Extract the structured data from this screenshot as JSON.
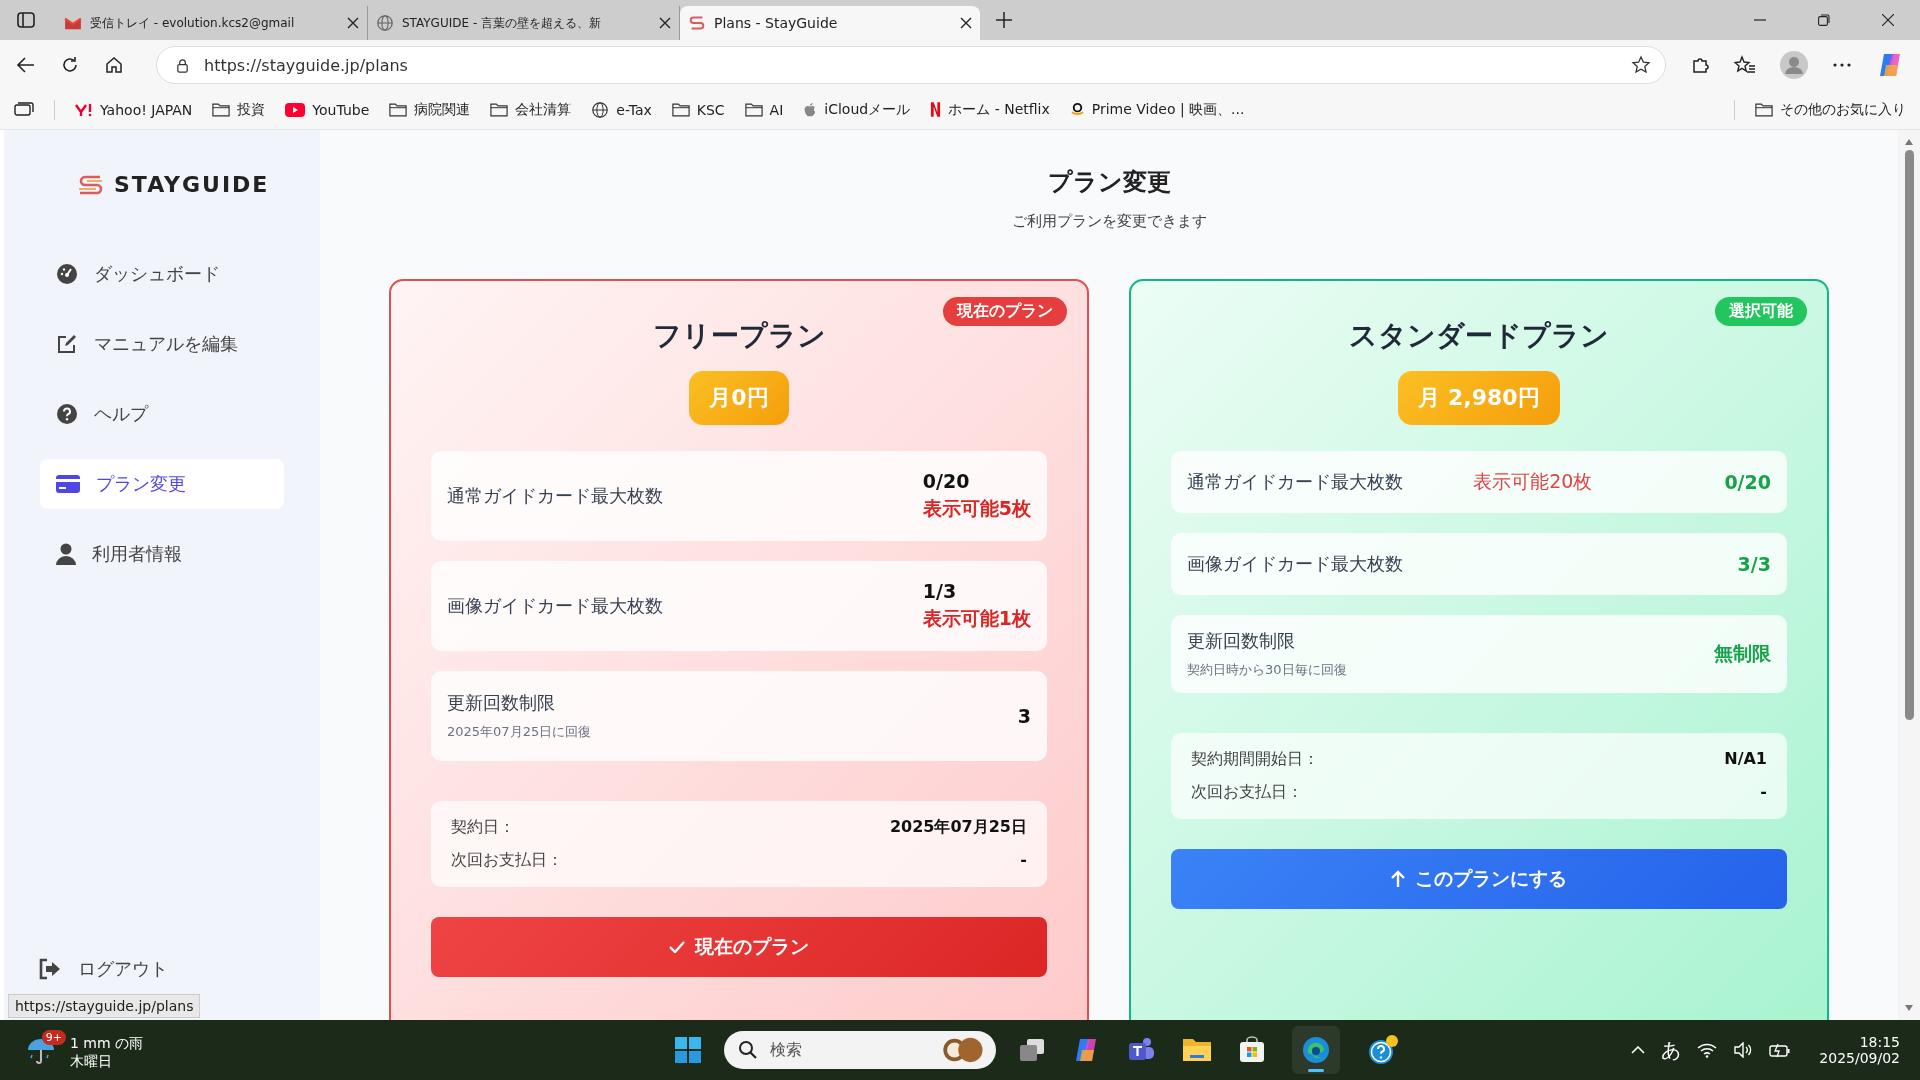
{
  "browser": {
    "tabs": [
      {
        "title": "受信トレイ - evolution.kcs2@gmail",
        "kind": "gmail",
        "selected": false
      },
      {
        "title": "STAYGUIDE - 言葉の壁を超える、新",
        "kind": "globe",
        "selected": false
      },
      {
        "title": "Plans - StayGuide",
        "kind": "stayguide",
        "selected": true
      }
    ],
    "address": "https://stayguide.jp/plans",
    "bookmarks": [
      {
        "label": "Yahoo! JAPAN",
        "kind": "yahoo"
      },
      {
        "label": "投資",
        "kind": "folder"
      },
      {
        "label": "YouTube",
        "kind": "youtube"
      },
      {
        "label": "病院関連",
        "kind": "folder"
      },
      {
        "label": "会社清算",
        "kind": "folder"
      },
      {
        "label": "e-Tax",
        "kind": "globe"
      },
      {
        "label": "KSC",
        "kind": "folder"
      },
      {
        "label": "AI",
        "kind": "folder"
      },
      {
        "label": "iCloudメール",
        "kind": "apple"
      },
      {
        "label": "ホーム - Netflix",
        "kind": "netflix"
      },
      {
        "label": "Prime Video | 映画、...",
        "kind": "amazon"
      }
    ],
    "other_bookmarks": "その他のお気に入り"
  },
  "sidebar": {
    "logo": "STAYGUIDE",
    "items": [
      {
        "label": "ダッシュボード",
        "kind": "dashboard",
        "selected": false
      },
      {
        "label": "マニュアルを編集",
        "kind": "edit",
        "selected": false
      },
      {
        "label": "ヘルプ",
        "kind": "help",
        "selected": false
      },
      {
        "label": "プラン変更",
        "kind": "card",
        "selected": true
      },
      {
        "label": "利用者情報",
        "kind": "user",
        "selected": false
      }
    ],
    "logout": "ログアウト"
  },
  "status_url": "https://stayguide.jp/plans",
  "page": {
    "title": "プラン変更",
    "subtitle": "ご利用プランを変更できます"
  },
  "plans": [
    {
      "kind": "current",
      "name": "フリープラン",
      "badge": "現在のプラン",
      "price": "月0円",
      "features": [
        {
          "label": "通常ガイドカード最大枚数",
          "value": "0/20",
          "note": "表示可能5枚"
        },
        {
          "label": "画像ガイドカード最大枚数",
          "value": "1/3",
          "note": "表示可能1枚"
        },
        {
          "label": "更新回数制限",
          "value": "3",
          "sub": "2025年07月25日に回復"
        }
      ],
      "contract": [
        {
          "label": "契約日：",
          "value": "2025年07月25日"
        },
        {
          "label": "次回お支払日：",
          "value": "-"
        }
      ],
      "button": "現在のプラン"
    },
    {
      "kind": "available",
      "name": "スタンダードプラン",
      "badge": "選択可能",
      "price": "月 2,980円",
      "features": [
        {
          "label": "通常ガイドカード最大枚数",
          "value": "0/20",
          "note": "表示可能20枚"
        },
        {
          "label": "画像ガイドカード最大枚数",
          "value": "3/3"
        },
        {
          "label": "更新回数制限",
          "value": "無制限",
          "sub": "契約日時から30日毎に回復"
        }
      ],
      "contract": [
        {
          "label": "契約期間開始日：",
          "value": "N/A1"
        },
        {
          "label": "次回お支払日：",
          "value": "-"
        }
      ],
      "button": "このプランにする"
    }
  ],
  "taskbar": {
    "weather": "1 mm の雨",
    "day": "木曜日",
    "badge": "9+",
    "search_placeholder": "検索",
    "ime": "あ",
    "time": "18:15",
    "date": "2025/09/02"
  }
}
